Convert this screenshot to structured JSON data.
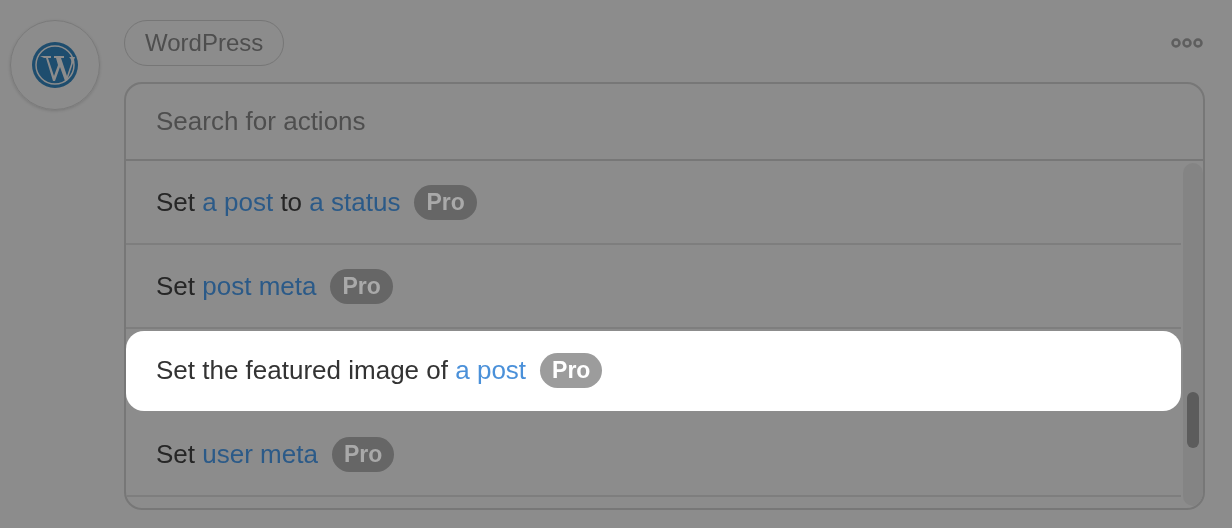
{
  "app": {
    "label": "WordPress"
  },
  "search": {
    "placeholder": "Search for actions"
  },
  "actions": [
    {
      "parts": [
        {
          "kind": "text",
          "text": "Set"
        },
        {
          "kind": "link",
          "text": "a post"
        },
        {
          "kind": "text",
          "text": "to"
        },
        {
          "kind": "link",
          "text": "a status"
        }
      ],
      "badge": "Pro",
      "selected": false
    },
    {
      "parts": [
        {
          "kind": "text",
          "text": "Set"
        },
        {
          "kind": "link",
          "text": "post meta"
        }
      ],
      "badge": "Pro",
      "selected": false
    },
    {
      "parts": [
        {
          "kind": "text",
          "text": "Set the featured image of"
        },
        {
          "kind": "link",
          "text": "a post"
        }
      ],
      "badge": "Pro",
      "selected": true
    },
    {
      "parts": [
        {
          "kind": "text",
          "text": "Set"
        },
        {
          "kind": "link",
          "text": "user meta"
        }
      ],
      "badge": "Pro",
      "selected": false
    }
  ]
}
